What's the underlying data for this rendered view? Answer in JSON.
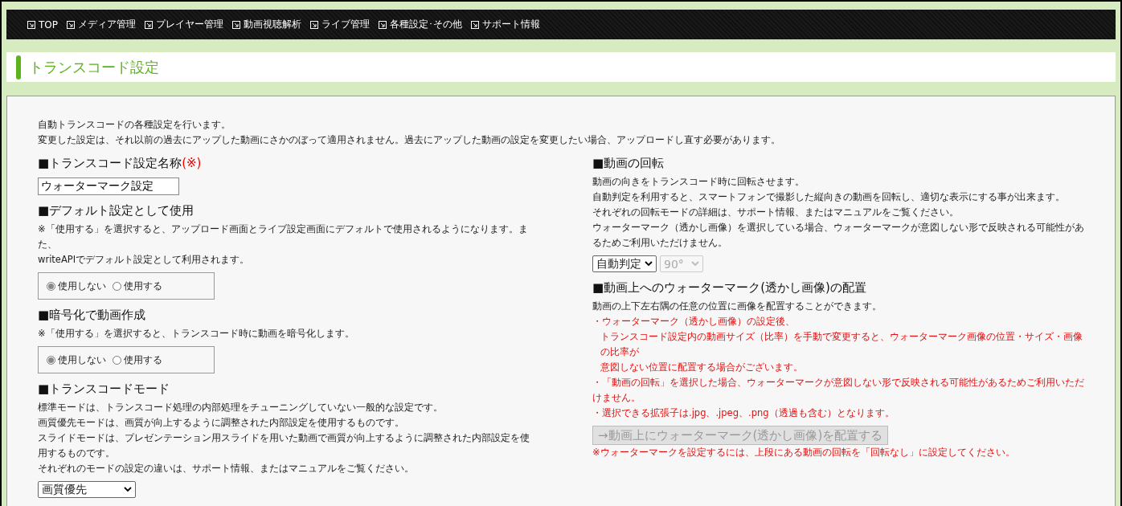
{
  "nav": [
    {
      "label": "TOP"
    },
    {
      "label": "メディア管理"
    },
    {
      "label": "プレイヤー管理"
    },
    {
      "label": "動画視聴解析"
    },
    {
      "label": "ライブ管理"
    },
    {
      "label": "各種設定･その他"
    },
    {
      "label": "サポート情報"
    }
  ],
  "page_title": "トランスコード設定",
  "intro": [
    "自動トランスコードの各種設定を行います。",
    "変更した設定は、それ以前の過去にアップした動画にさかのぼって適用されません。過去にアップした動画の設定を変更したい場合、アップロードし直す必要があります。"
  ],
  "left": [
    {
      "kind": "text",
      "heading": "■トランスコード設定名称",
      "required": "(※)",
      "value": "ウォーターマーク設定"
    },
    {
      "kind": "radio",
      "heading": "■デフォルト設定として使用",
      "notes": [
        "※「使用する」を選択すると、アップロード画面とライブ設定画面にデフォルトで使用されるようになります。また、",
        "writeAPIでデフォルト設定として利用されます。"
      ],
      "options": [
        {
          "label": "使用しない",
          "selected": true
        },
        {
          "label": "使用する",
          "selected": false
        }
      ]
    },
    {
      "kind": "radio",
      "heading": "■暗号化で動画作成",
      "notes": [
        "※「使用する」を選択すると、トランスコード時に動画を暗号化します。"
      ],
      "options": [
        {
          "label": "使用しない",
          "selected": true
        },
        {
          "label": "使用する",
          "selected": false
        }
      ]
    },
    {
      "kind": "select",
      "heading": "■トランスコードモード",
      "notes": [
        "標準モードは、トランスコード処理の内部処理をチューニングしていない一般的な設定です。",
        "画質優先モードは、画質が向上するように調整された内部設定を使用するものです。",
        "スライドモードは、プレゼンテーション用スライドを用いた動画で画質が向上するように調整された内部設定を使用するものです。",
        "それぞれのモードの設定の違いは、サポート情報、またはマニュアルをご覧ください。"
      ],
      "selects": [
        {
          "value": "画質優先",
          "disabled": false
        }
      ]
    }
  ],
  "right": [
    {
      "kind": "select",
      "heading": "■動画の回転",
      "notes": [
        "動画の向きをトランスコード時に回転させます。",
        "自動判定を利用すると、スマートフォンで撮影した縦向きの動画を回転し、適切な表示にする事が出来ます。",
        "それぞれの回転モードの詳細は、サポート情報、またはマニュアルをご覧ください。",
        "ウォーターマーク（透かし画像）を選択している場合、ウォーターマークが意図しない形で反映される可能性があるためご利用いただけません。"
      ],
      "selects": [
        {
          "value": "自動判定",
          "disabled": false
        },
        {
          "value": "90°",
          "disabled": true
        }
      ]
    },
    {
      "kind": "button",
      "heading": "■動画上へのウォーターマーク(透かし画像)の配置",
      "notes": [
        "動画の上下左右隅の任意の位置に画像を配置することができます。"
      ],
      "warnings": [
        [
          "・ウォーターマーク（透かし画像）の設定後、",
          "トランスコード設定内の動画サイズ（比率）を手動で変更すると、ウォーターマーク画像の位置・サイズ・画像の比率が",
          "意図しない位置に配置する場合がございます。"
        ],
        [
          "・「動画の回転」を選択した場合、ウォーターマークが意図しない形で反映される可能性があるためご利用いただけません。"
        ],
        [
          "・選択できる拡張子は.jpg、.jpeg、.png（透過も含む）となります。"
        ]
      ],
      "button": {
        "label": "→動画上にウォーターマーク(透かし画像)を配置する",
        "disabled": true
      },
      "footnote": "※ウォーターマークを設定するには、上段にある動画の回転を「回転なし」に設定してください。"
    }
  ]
}
